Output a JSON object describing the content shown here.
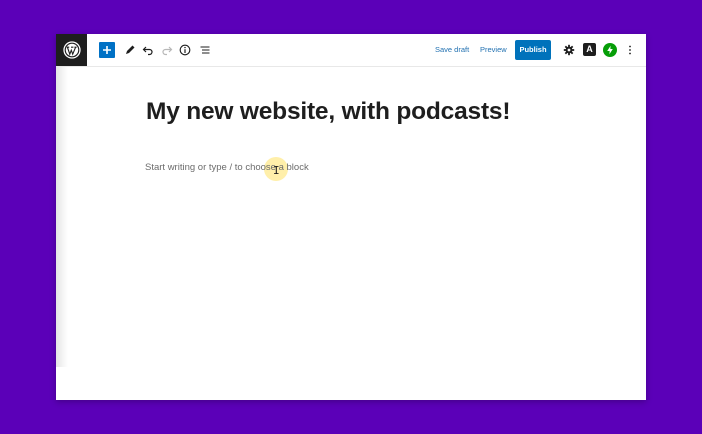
{
  "toolbar": {
    "save_draft": "Save draft",
    "preview": "Preview",
    "publish": "Publish",
    "astra_label": "A",
    "icons": [
      "wordpress-logo",
      "plus-icon",
      "pencil-icon",
      "undo-icon",
      "redo-icon",
      "info-icon",
      "list-view-icon",
      "gear-icon",
      "astra-icon",
      "jetpack-icon",
      "more-vertical-icon"
    ]
  },
  "editor": {
    "title": "My new website, with podcasts!",
    "placeholder": "Start writing or type / to choose a block"
  },
  "colors": {
    "background": "#5b00b8",
    "publish": "#0072bb",
    "link": "#2271b1",
    "jetpack": "#069e08"
  }
}
